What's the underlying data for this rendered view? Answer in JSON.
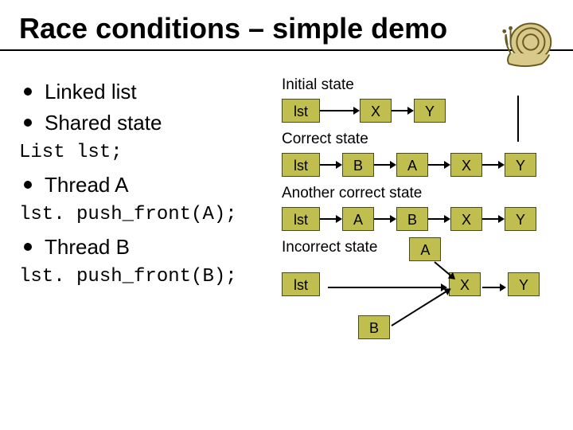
{
  "title": "Race conditions – simple demo",
  "bullets": {
    "linked_list": "Linked list",
    "shared_state": "Shared state",
    "thread_a": "Thread A",
    "thread_b": "Thread B"
  },
  "code": {
    "decl": "List lst;",
    "push_a": "lst. push_front(A);",
    "push_b": "lst. push_front(B);"
  },
  "labels": {
    "initial": "Initial state",
    "correct": "Correct state",
    "another": "Another correct state",
    "incorrect": "Incorrect state"
  },
  "nodes": {
    "lst": "lst",
    "A": "A",
    "B": "B",
    "X": "X",
    "Y": "Y"
  },
  "chart_data": {
    "type": "diagram",
    "states": [
      {
        "name": "Initial state",
        "chain": [
          "lst",
          "X",
          "Y"
        ]
      },
      {
        "name": "Correct state",
        "chain": [
          "lst",
          "B",
          "A",
          "X",
          "Y"
        ]
      },
      {
        "name": "Another correct state",
        "chain": [
          "lst",
          "A",
          "B",
          "X",
          "Y"
        ]
      },
      {
        "name": "Incorrect state",
        "lst_points_to": "X",
        "chain": [
          "X",
          "Y"
        ],
        "dangling": [
          {
            "node": "A",
            "points_to": "X"
          },
          {
            "node": "B",
            "points_to": "X"
          }
        ]
      }
    ]
  }
}
